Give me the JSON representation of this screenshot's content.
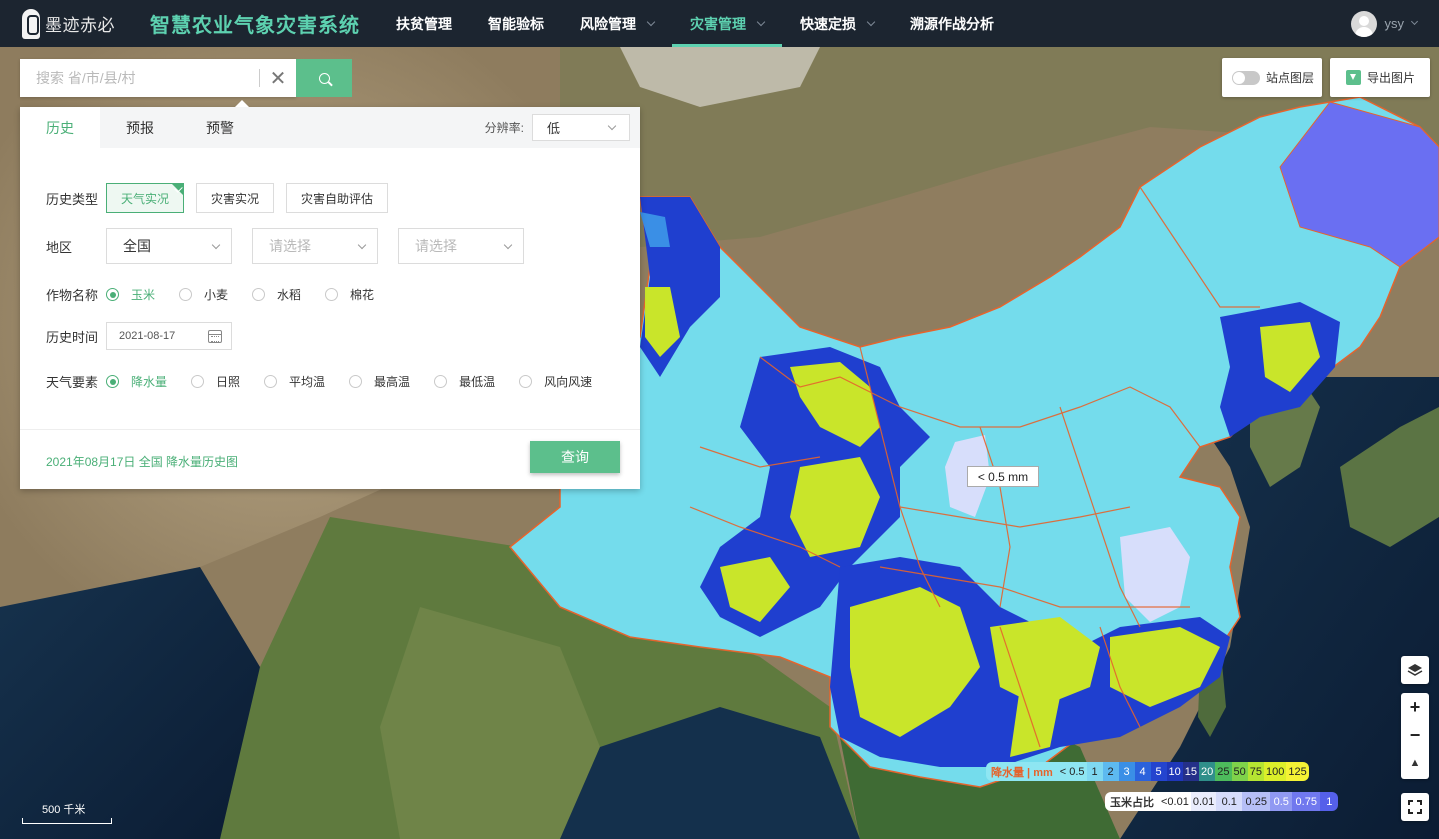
{
  "brand": {
    "logo_text": "墨迹赤必",
    "app_title": "智慧农业气象灾害系统"
  },
  "nav": [
    {
      "label": "扶贫管理",
      "dropdown": false,
      "active": false
    },
    {
      "label": "智能验标",
      "dropdown": false,
      "active": false
    },
    {
      "label": "风险管理",
      "dropdown": true,
      "active": false
    },
    {
      "label": "灾害管理",
      "dropdown": true,
      "active": true
    },
    {
      "label": "快速定损",
      "dropdown": true,
      "active": false
    },
    {
      "label": "溯源作战分析",
      "dropdown": false,
      "active": false
    }
  ],
  "user": {
    "name": "ysy"
  },
  "search": {
    "placeholder": "搜索 省/市/县/村",
    "value": ""
  },
  "panel": {
    "tabs": [
      {
        "label": "历史",
        "active": true
      },
      {
        "label": "预报",
        "active": false
      },
      {
        "label": "预警",
        "active": false
      }
    ],
    "resolution": {
      "label": "分辨率:",
      "value": "低"
    },
    "history_type": {
      "label": "历史类型",
      "options": [
        {
          "label": "天气实况",
          "selected": true
        },
        {
          "label": "灾害实况",
          "selected": false
        },
        {
          "label": "灾害自助评估",
          "selected": false
        }
      ]
    },
    "region": {
      "label": "地区",
      "province": "全国",
      "city_placeholder": "请选择",
      "county_placeholder": "请选择"
    },
    "crop": {
      "label": "作物名称",
      "options": [
        {
          "label": "玉米",
          "checked": true
        },
        {
          "label": "小麦",
          "checked": false
        },
        {
          "label": "水稻",
          "checked": false
        },
        {
          "label": "棉花",
          "checked": false
        }
      ]
    },
    "history_time": {
      "label": "历史时间",
      "value": "2021-08-17"
    },
    "weather": {
      "label": "天气要素",
      "options": [
        {
          "label": "降水量",
          "checked": true
        },
        {
          "label": "日照",
          "checked": false
        },
        {
          "label": "平均温",
          "checked": false
        },
        {
          "label": "最高温",
          "checked": false
        },
        {
          "label": "最低温",
          "checked": false
        },
        {
          "label": "风向风速",
          "checked": false
        }
      ]
    },
    "summary": "2021年08月17日 全国 降水量历史图",
    "query_label": "查询"
  },
  "toolbar": {
    "station_layer": "站点图层",
    "export_image": "导出图片"
  },
  "map": {
    "tooltip": "< 0.5 mm",
    "scale_label": "500 千米",
    "colors": {
      "base_cyan": "#74dcec",
      "blue_dark": "#1f3fcf",
      "blue_mid": "#3a8fe6",
      "yellow_green": "#c9e52a",
      "light_lavender": "#d7defb",
      "periwinkle": "#6a6ff2",
      "border_orange": "#e5642d"
    }
  },
  "controls": {
    "layers_icon": "layers-icon",
    "zoom_in": "+",
    "zoom_out": "−",
    "compass": "▲"
  },
  "precip_legend": {
    "title": "降水量 | mm",
    "items": [
      {
        "label": "< 0.5",
        "color": "#8ee6f2"
      },
      {
        "label": "1",
        "color": "#7fd8f1"
      },
      {
        "label": "2",
        "color": "#5dbaf0"
      },
      {
        "label": "3",
        "color": "#3a8fe6"
      },
      {
        "label": "4",
        "color": "#2b62dc"
      },
      {
        "label": "5",
        "color": "#2444cf"
      },
      {
        "label": "10",
        "color": "#1f36b8"
      },
      {
        "label": "15",
        "color": "#243089"
      },
      {
        "label": "20",
        "color": "#2f8f8a"
      },
      {
        "label": "25",
        "color": "#4dbb5c"
      },
      {
        "label": "50",
        "color": "#7fd34a"
      },
      {
        "label": "75",
        "color": "#b5e532"
      },
      {
        "label": "100",
        "color": "#dcef2a"
      },
      {
        "label": "125",
        "color": "#f4f235"
      }
    ]
  },
  "corn_legend": {
    "title": "玉米占比",
    "items": [
      {
        "label": "<0.01",
        "color": "#ffffff"
      },
      {
        "label": "0.01",
        "color": "#eaedfd"
      },
      {
        "label": "0.1",
        "color": "#d6dcfb"
      },
      {
        "label": "0.25",
        "color": "#b6bff6"
      },
      {
        "label": "0.5",
        "color": "#9099f2"
      },
      {
        "label": "0.75",
        "color": "#7078ee"
      },
      {
        "label": "1",
        "color": "#5560ea"
      }
    ]
  }
}
